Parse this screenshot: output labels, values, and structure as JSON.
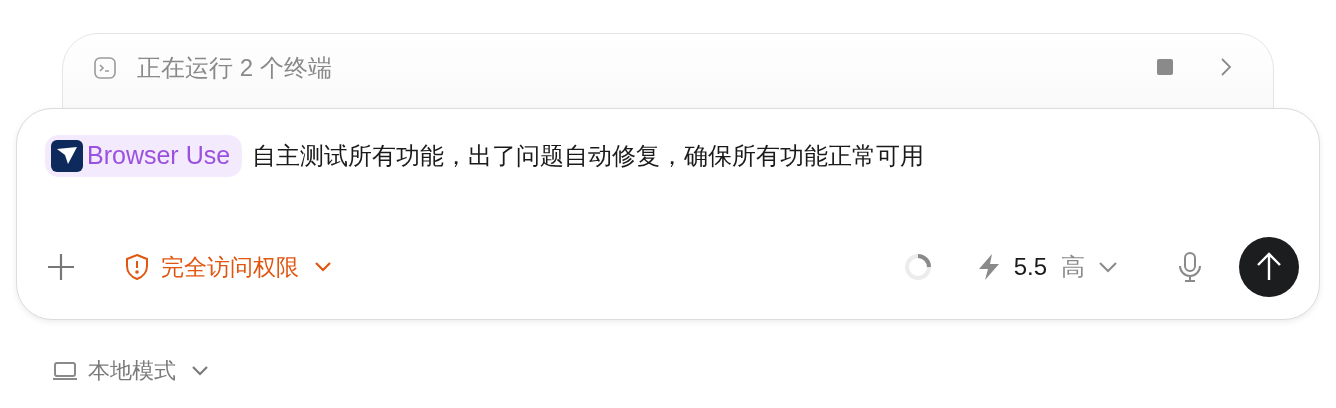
{
  "terminal_bar": {
    "label": "正在运行 2 个终端"
  },
  "composer": {
    "mention": {
      "label": "Browser Use"
    },
    "message": "自主测试所有功能，出了问题自动修复，确保所有功能正常可用",
    "permission": {
      "label": "完全访问权限"
    },
    "model": {
      "version": "5.5",
      "effort": "高"
    }
  },
  "mode": {
    "label": "本地模式"
  }
}
